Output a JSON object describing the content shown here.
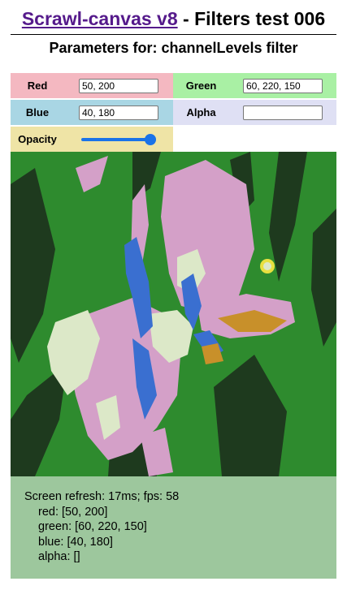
{
  "header": {
    "link_text": "Scrawl-canvas v8",
    "title_suffix": " - Filters test 006",
    "subtitle": "Parameters for: channelLevels filter"
  },
  "controls": {
    "red": {
      "label": "Red",
      "value": "50, 200"
    },
    "green": {
      "label": "Green",
      "value": "60, 220, 150"
    },
    "blue": {
      "label": "Blue",
      "value": "40, 180"
    },
    "alpha": {
      "label": "Alpha",
      "value": ""
    },
    "opacity": {
      "label": "Opacity",
      "value": 1.0
    }
  },
  "report": {
    "refresh": "Screen refresh: 17ms; fps: 58",
    "red": "red: [50, 200]",
    "green": "green: [60, 220, 150]",
    "blue": "blue: [40, 180]",
    "alpha": "alpha: []"
  },
  "colors": {
    "link": "#551a8b",
    "red_panel": "#f4b8c1",
    "green_panel": "#a9f0a4",
    "blue_panel": "#a9d6e4",
    "alpha_panel": "#dfe0f4",
    "opacity_panel": "#efe4a6",
    "report_bg": "#9dc79d",
    "slider": "#1a73e8"
  },
  "canvas": {
    "image": "iris-flower-posterized",
    "palette": [
      "#2e8b2e",
      "#1e3a1e",
      "#d4a0c8",
      "#dce8c8",
      "#3a6fd0",
      "#c8902a",
      "#e8e040"
    ]
  }
}
